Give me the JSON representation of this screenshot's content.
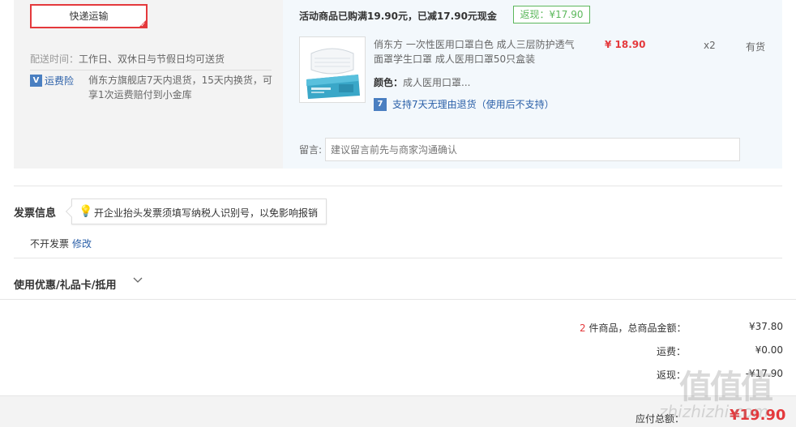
{
  "shipping": {
    "method_label": "快递运输",
    "delivery_prefix": "配送时间：",
    "delivery_value": "工作日、双休日与节假日均可送货",
    "insurance_icon_char": "V",
    "insurance_label": "运费险",
    "insurance_desc": "俏东方旗舰店7天内退货，15天内换货，可享1次运费赔付到小金库"
  },
  "goods": {
    "promo_text": "活动商品已购满19.90元，已减17.90元现金",
    "rebate_badge": "返现：¥17.90",
    "product_name": "俏东方 一次性医用口罩白色 成人三层防护透气面罩学生口罩 成人医用口罩50只盒装",
    "price": "¥ 18.90",
    "qty": "x2",
    "stock": "有货",
    "color_label": "颜色：",
    "color_value": "成人医用口罩...",
    "return_icon_char": "7",
    "return_policy": "支持7天无理由退货（使用后不支持）",
    "thumb_icon": "mask-product-image"
  },
  "remark": {
    "label": "留言:",
    "placeholder": "建议留言前先与商家沟通确认"
  },
  "invoice": {
    "title": "发票信息",
    "tip": "开企业抬头发票须填写纳税人识别号，以免影响报销",
    "status": "不开发票",
    "edit_link": "修改"
  },
  "coupon": {
    "title": "使用优惠/礼品卡/抵用",
    "chevron_icon": "chevron-down-icon"
  },
  "summary": {
    "item_count": "2",
    "item_count_label": "件商品，总商品金额：",
    "goods_total": "¥37.80",
    "shipping_label": "运费：",
    "shipping_value": "¥0.00",
    "rebate_label": "返现：",
    "rebate_value": "-¥17.90",
    "total_label": "应付总额：",
    "total_value": "¥19.90"
  },
  "watermark": {
    "main": "值值值",
    "sub": "zhizhizhi.com"
  },
  "colors": {
    "accent_red": "#e4393c",
    "link_blue": "#2a5fa8",
    "rebate_green": "#5cb85c"
  }
}
